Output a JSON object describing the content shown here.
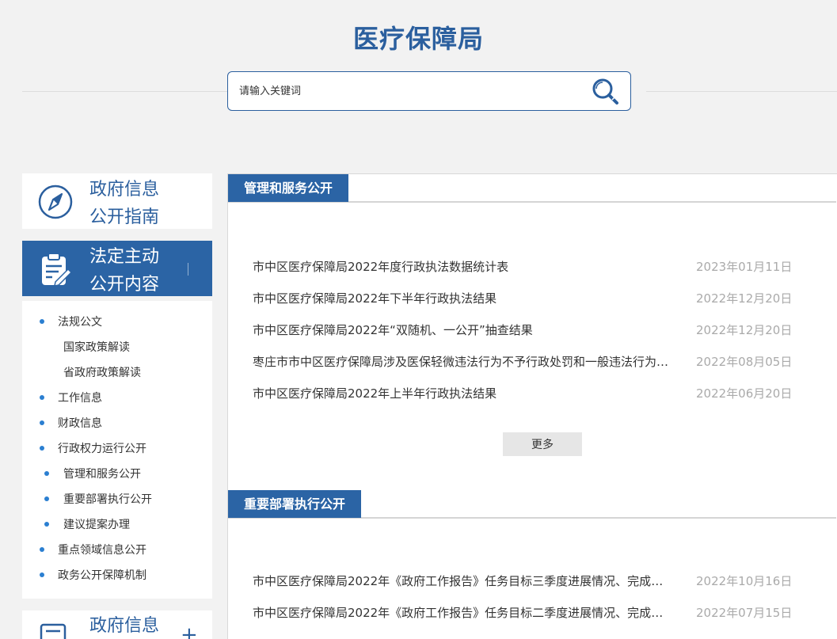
{
  "header": {
    "title": "医疗保障局"
  },
  "search": {
    "placeholder": "请输入关键词",
    "value": ""
  },
  "sidebar": {
    "guide_line1": "政府信息",
    "guide_line2": "公开指南",
    "active_line1": "法定主动",
    "active_line2": "公开内容",
    "items": [
      {
        "label": "法规公文"
      },
      {
        "label": "国家政策解读"
      },
      {
        "label": "省政府政策解读"
      },
      {
        "label": "工作信息"
      },
      {
        "label": "财政信息"
      },
      {
        "label": "行政权力运行公开"
      },
      {
        "label": "管理和服务公开"
      },
      {
        "label": "重要部署执行公开"
      },
      {
        "label": "建议提案办理"
      },
      {
        "label": "重点领域信息公开"
      },
      {
        "label": "政务公开保障机制"
      }
    ],
    "bottom_line1": "政府信息",
    "bottom_plus": "+"
  },
  "sections": [
    {
      "title": "管理和服务公开",
      "more_label": "更多",
      "items": [
        {
          "title": "市中区医疗保障局2022年度行政执法数据统计表",
          "date": "2023年01月11日"
        },
        {
          "title": "市中区医疗保障局2022年下半年行政执法结果",
          "date": "2022年12月20日"
        },
        {
          "title": "市中区医疗保障局2022年“双随机、一公开”抽查结果",
          "date": "2022年12月20日"
        },
        {
          "title": "枣庄市市中区医疗保障局涉及医保轻微违法行为不予行政处罚和一般违法行为减轻行政处罚清单",
          "date": "2022年08月05日"
        },
        {
          "title": "市中区医疗保障局2022年上半年行政执法结果",
          "date": "2022年06月20日"
        }
      ]
    },
    {
      "title": "重要部署执行公开",
      "items": [
        {
          "title": "市中区医疗保障局2022年《政府工作报告》任务目标三季度进展情况、完成情况",
          "date": "2022年10月16日"
        },
        {
          "title": "市中区医疗保障局2022年《政府工作报告》任务目标二季度进展情况、完成情况",
          "date": "2022年07月15日"
        }
      ]
    }
  ],
  "colors": {
    "brand": "#2b64a5",
    "title": "#2b5f9e",
    "date": "#aaaaaa",
    "dot": "#2b7fd1"
  }
}
